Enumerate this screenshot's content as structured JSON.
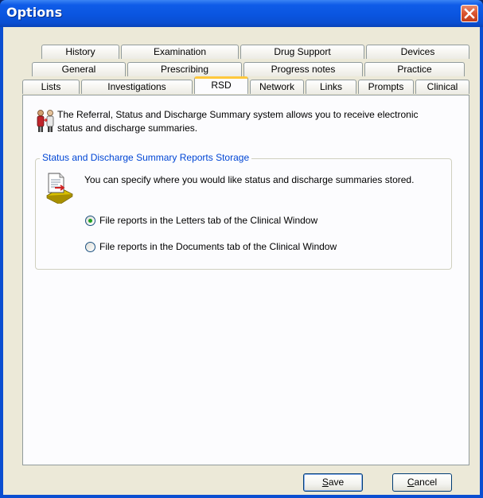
{
  "window": {
    "title": "Options"
  },
  "tabs": {
    "row1": [
      "History",
      "Examination",
      "Drug Support",
      "Devices"
    ],
    "row2": [
      "General",
      "Prescribing",
      "Progress notes",
      "Practice"
    ],
    "row3": [
      "Lists",
      "Investigations",
      "RSD",
      "Network",
      "Links",
      "Prompts",
      "Clinical"
    ],
    "active": "RSD"
  },
  "intro": {
    "text": "The Referral, Status and Discharge Summary system allows you to receive electronic status and discharge summaries."
  },
  "storage_group": {
    "title": "Status and Discharge Summary Reports Storage",
    "description": "You can specify where you would like status and discharge summaries stored.",
    "options": [
      {
        "label": "File reports in the Letters tab of the Clinical Window",
        "selected": true
      },
      {
        "label": "File reports in the Documents tab of the Clinical Window",
        "selected": false
      }
    ]
  },
  "buttons": {
    "save": {
      "mnemonic": "S",
      "rest": "ave"
    },
    "cancel": {
      "mnemonic": "C",
      "rest": "ancel"
    }
  },
  "icons": [
    "close-icon",
    "people-icon",
    "document-icon"
  ],
  "colors": {
    "title_bar": "#0a55e0",
    "active_tab_highlight": "#ffc83c",
    "group_title": "#0046d5",
    "radio_selected": "#21a121"
  }
}
